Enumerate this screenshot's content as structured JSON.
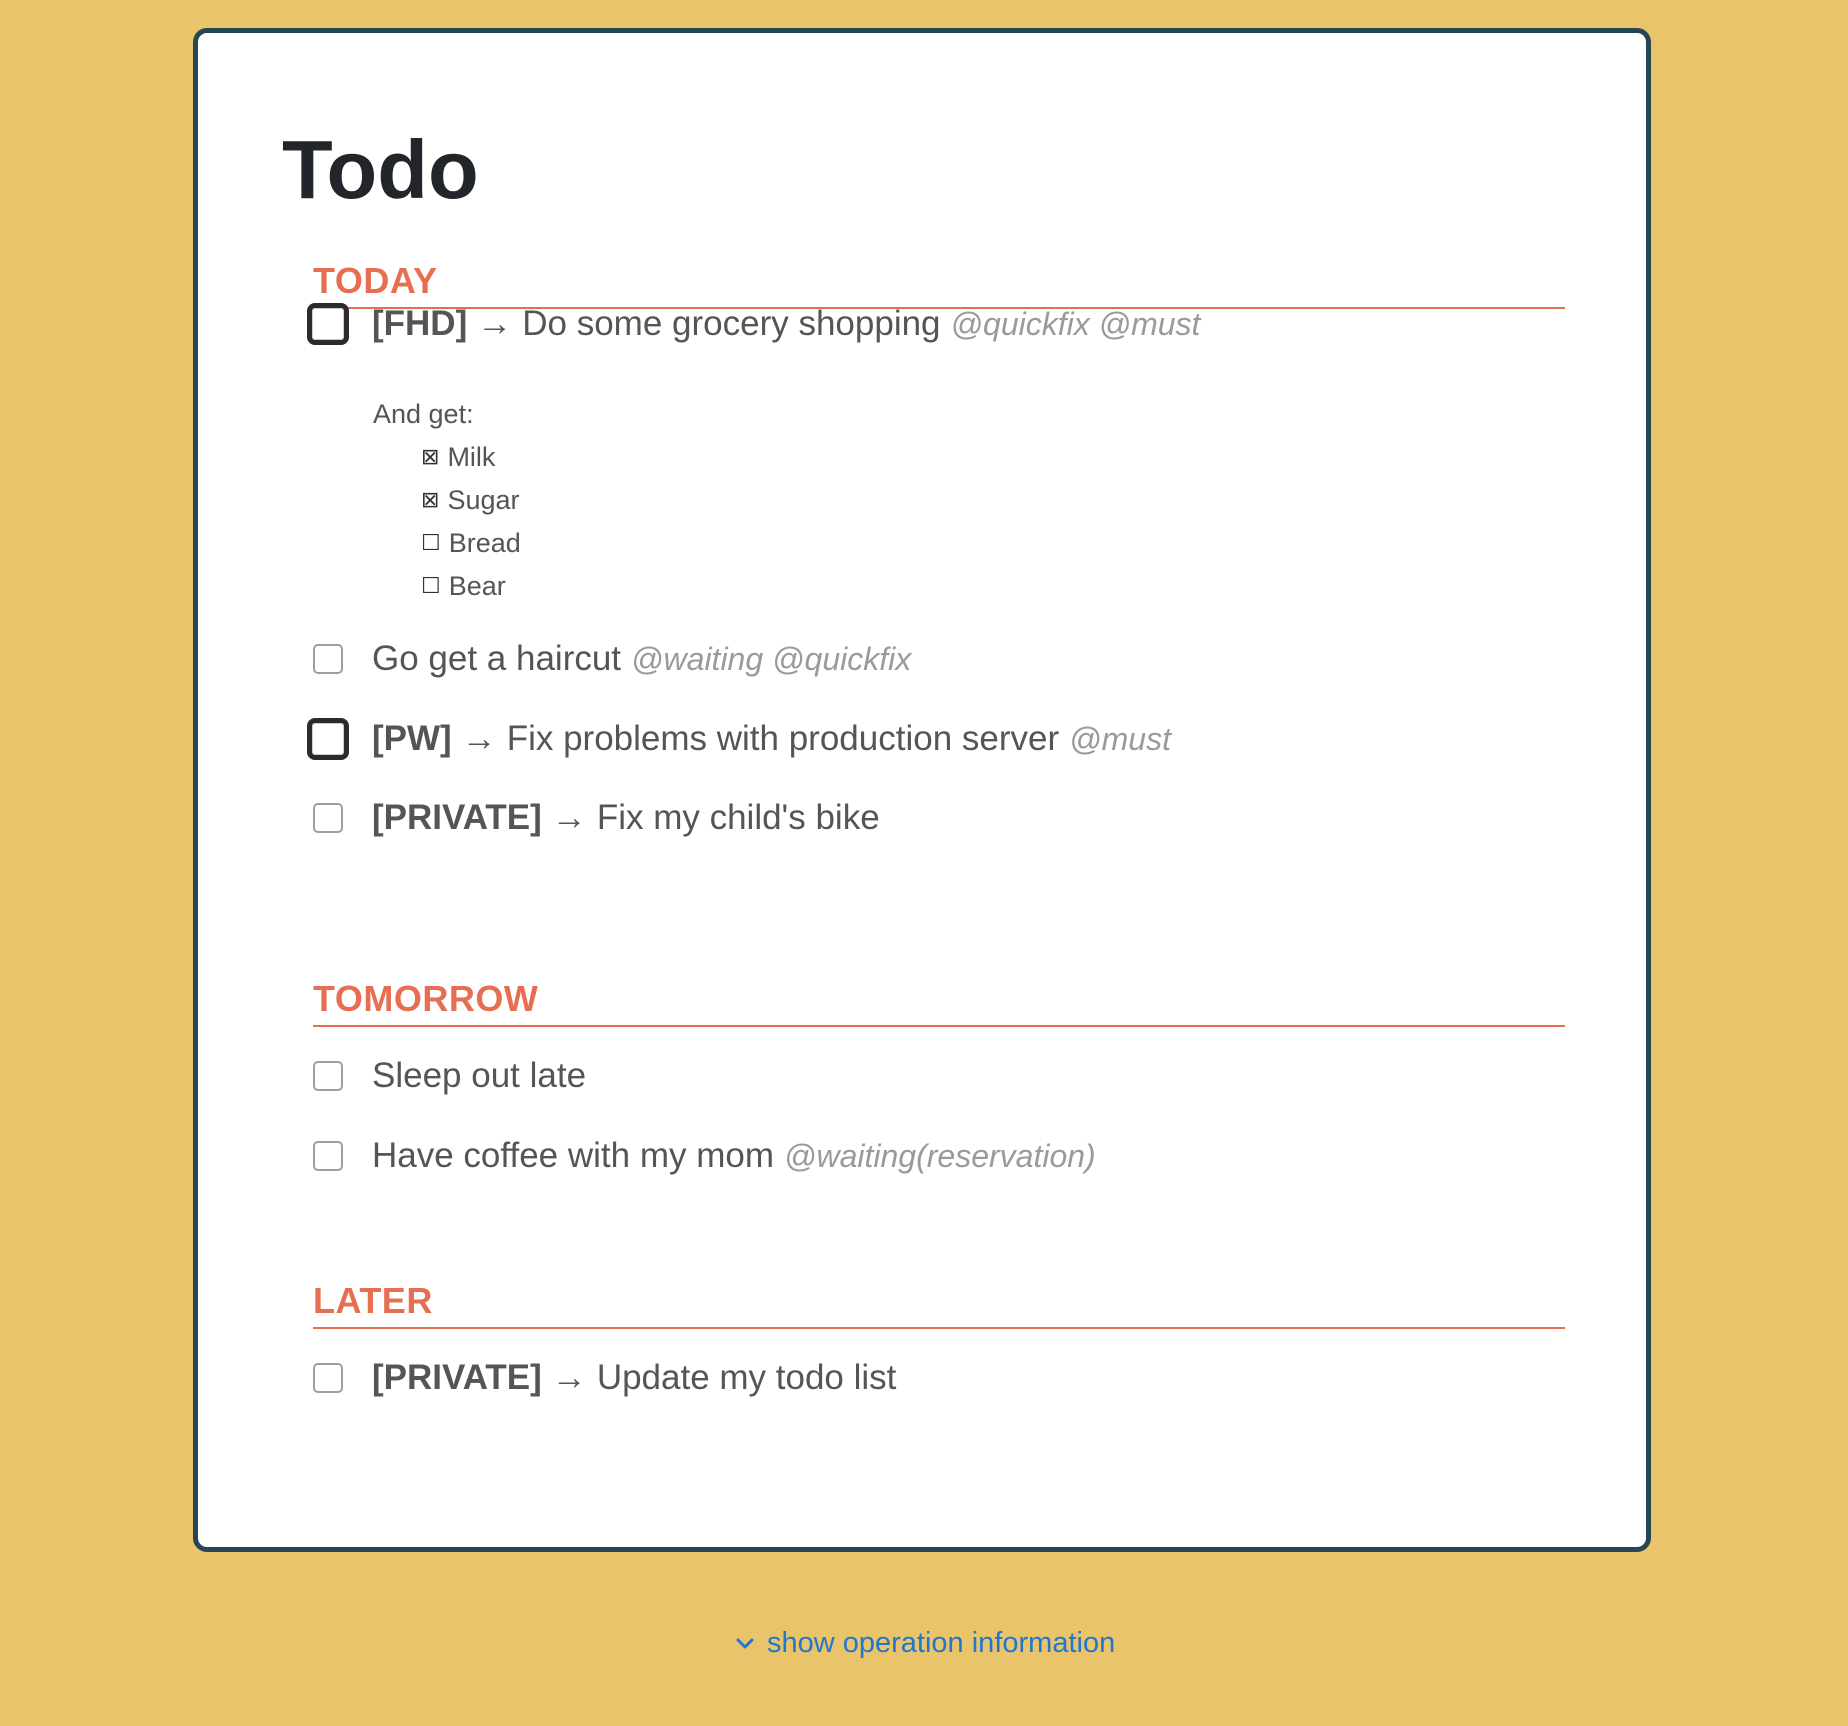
{
  "title": "Todo",
  "sections": [
    {
      "header": "TODAY",
      "tasks": [
        {
          "tag": "[FHD]",
          "arrow": "→",
          "text": "Do some grocery shopping",
          "contexts": "@quickfix @must",
          "must": true,
          "note": {
            "heading": "And get:",
            "items": [
              {
                "glyph": "⊠",
                "label": "Milk"
              },
              {
                "glyph": "⊠",
                "label": "Sugar"
              },
              {
                "glyph": "☐",
                "label": "Bread"
              },
              {
                "glyph": "☐",
                "label": "Bear"
              }
            ]
          }
        },
        {
          "text": "Go get a haircut",
          "contexts": "@waiting @quickfix",
          "must": false
        },
        {
          "tag": "[PW]",
          "arrow": "→",
          "text": "Fix problems with production server",
          "contexts": "@must",
          "must": true
        },
        {
          "tag": "[PRIVATE]",
          "arrow": "→",
          "text": "Fix my child's bike",
          "must": false
        }
      ]
    },
    {
      "header": "TOMORROW",
      "tasks": [
        {
          "text": "Sleep out late",
          "must": false
        },
        {
          "text": "Have coffee with my mom",
          "contexts": "@waiting(reservation)",
          "must": false
        }
      ]
    },
    {
      "header": "LATER",
      "tasks": [
        {
          "tag": "[PRIVATE]",
          "arrow": "→",
          "text": "Update my todo list",
          "must": false
        }
      ]
    }
  ],
  "footer": {
    "link_label": "show operation information",
    "icon": "chevron-down-icon"
  },
  "colors": {
    "background": "#e9c46a",
    "card_border": "#264653",
    "section_accent": "#e76f51",
    "link": "#1f77d0"
  }
}
